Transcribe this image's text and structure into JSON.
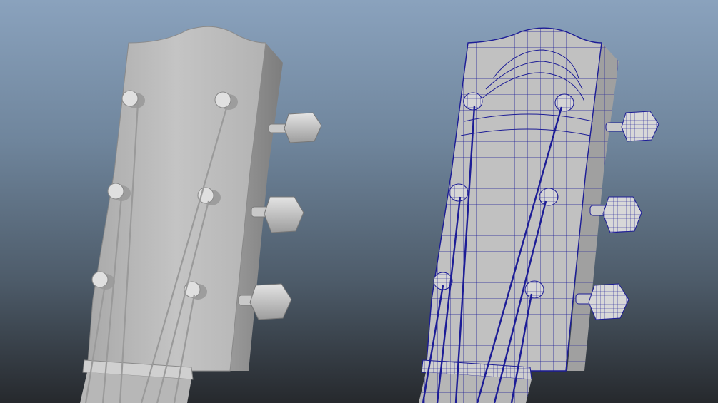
{
  "scene": {
    "subject": "guitar-headstock-3d-render",
    "colors": {
      "background_top": "#8aa2bd",
      "background_bottom": "#26292d",
      "surface": "#bdbdbd",
      "surface_light": "#d3d3d3",
      "surface_dark": "#8f8f8f",
      "wire_color": "#1c1c96"
    },
    "models": [
      {
        "id": "shaded-headstock",
        "shading": "smooth",
        "tuning_pegs": 6,
        "strings": 6
      },
      {
        "id": "wireframe-headstock",
        "shading": "wireframe-on-shaded",
        "tuning_pegs": 6,
        "strings": 6
      }
    ]
  }
}
